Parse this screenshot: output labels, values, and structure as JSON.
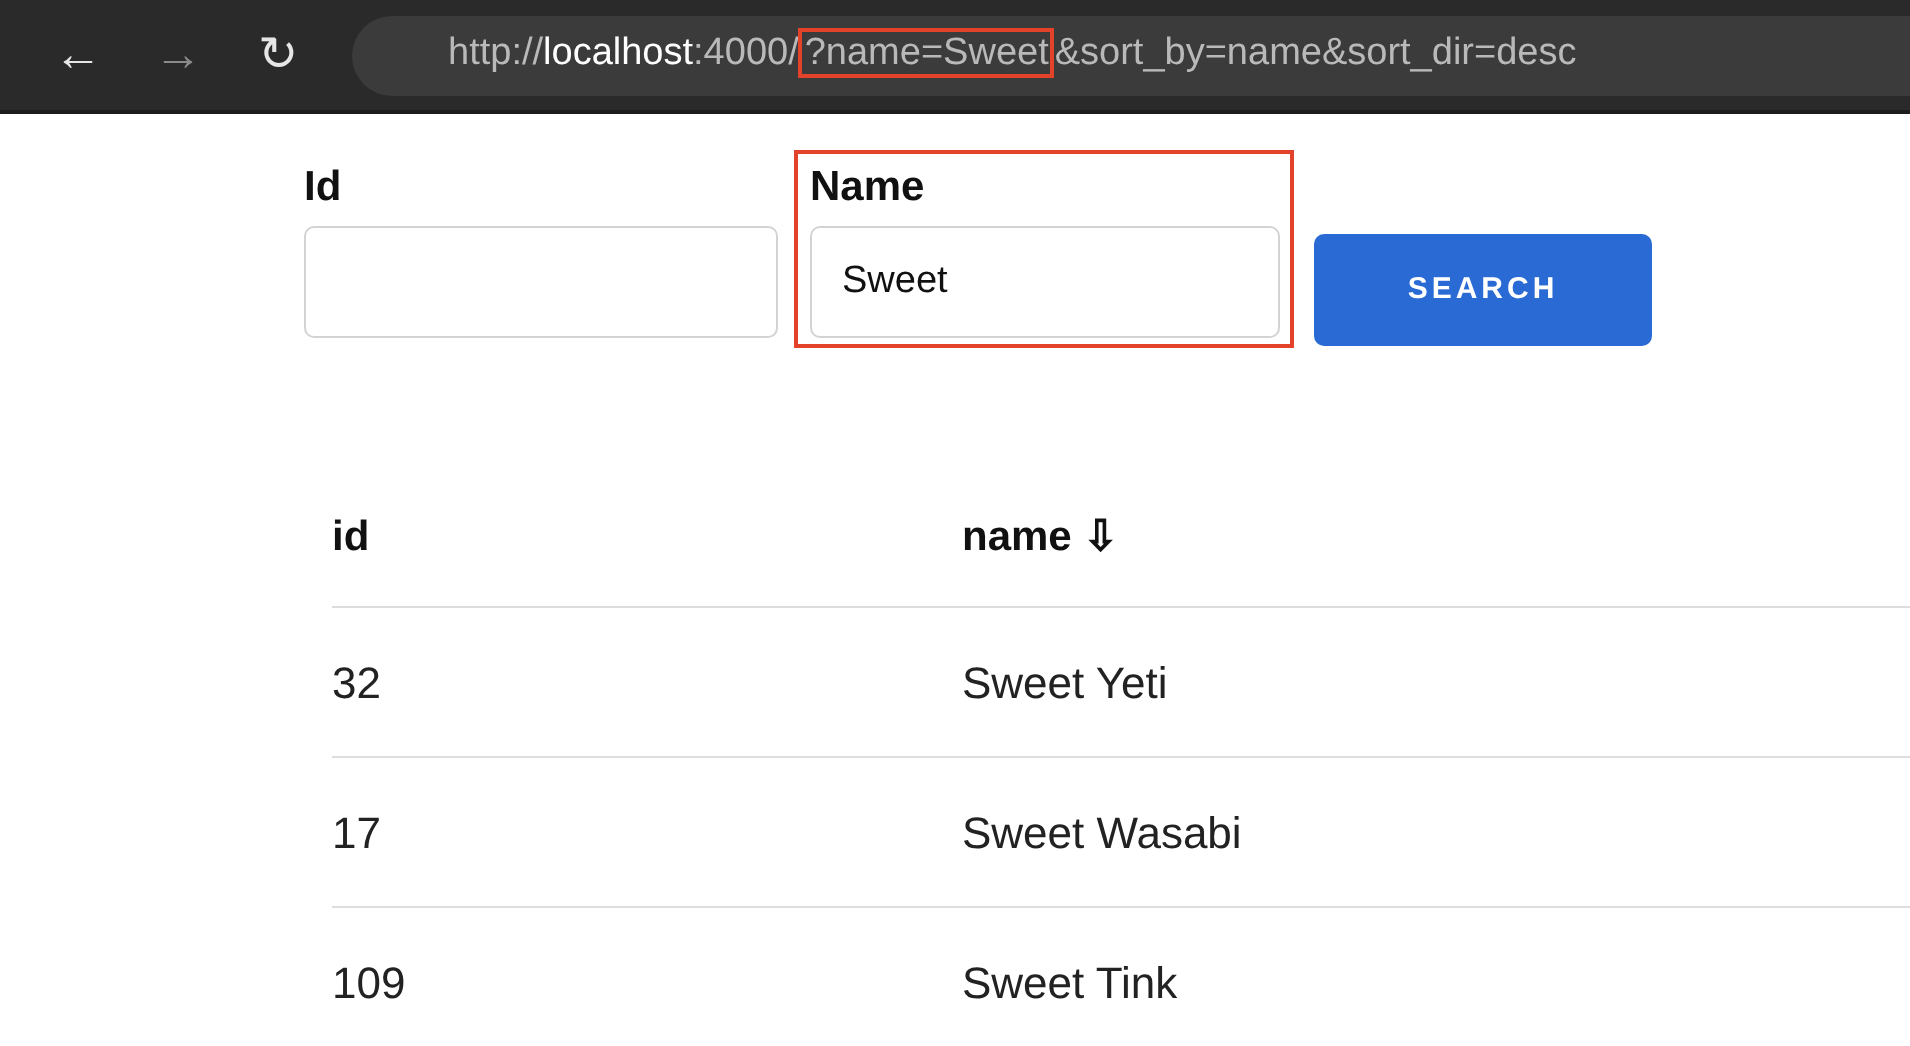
{
  "browser": {
    "back": "←",
    "forward": "→",
    "reload": "↻",
    "forward_disabled": true,
    "url": {
      "scheme": "http://",
      "host": "localhost",
      "port": ":4000/",
      "query_highlighted": "?name=Sweet",
      "query_rest": "&sort_by=name&sort_dir=desc"
    }
  },
  "filters": [
    {
      "label": "Id",
      "highlighted": false
    },
    {
      "label": "Name",
      "value": "Sweet",
      "highlighted": true
    }
  ],
  "search_button": "SEARCH",
  "table": {
    "columns": [
      {
        "label": "id"
      },
      {
        "label": "name",
        "sort_indicator": "⇩"
      }
    ],
    "rows": [
      [
        "32",
        "Sweet Yeti"
      ],
      [
        "17",
        "Sweet Wasabi"
      ],
      [
        "109",
        "Sweet Tink"
      ]
    ]
  }
}
